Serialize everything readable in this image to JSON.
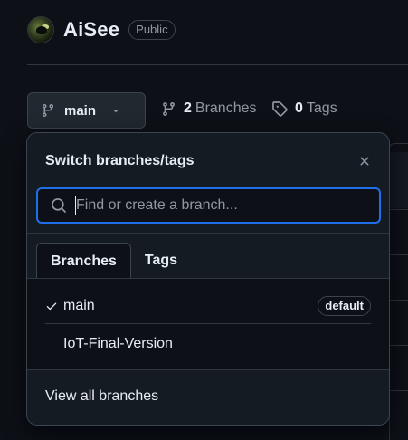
{
  "repo": {
    "name": "AiSee",
    "visibility": "Public"
  },
  "toolbar": {
    "current_branch": "main",
    "branches_count": "2",
    "branches_label": "Branches",
    "tags_count": "0",
    "tags_label": "Tags"
  },
  "popover": {
    "title": "Switch branches/tags",
    "search_placeholder": "Find or create a branch...",
    "tabs": [
      {
        "label": "Branches",
        "active": true
      },
      {
        "label": "Tags",
        "active": false
      }
    ],
    "branches": [
      {
        "name": "main",
        "selected": true,
        "badge": "default"
      },
      {
        "name": "IoT-Final-Version",
        "selected": false,
        "badge": ""
      }
    ],
    "footer_link": "View all branches"
  },
  "icons": {
    "branch": "git-branch-icon",
    "tag": "tag-icon",
    "caret": "caret-down-icon",
    "close": "close-icon",
    "search": "search-icon",
    "check": "check-icon"
  },
  "colors": {
    "background": "#0d1117",
    "surface": "#151b23",
    "border": "#3d444d",
    "accent_focus": "#1f6feb",
    "text": "#e6edf3",
    "muted": "#9198a1"
  }
}
